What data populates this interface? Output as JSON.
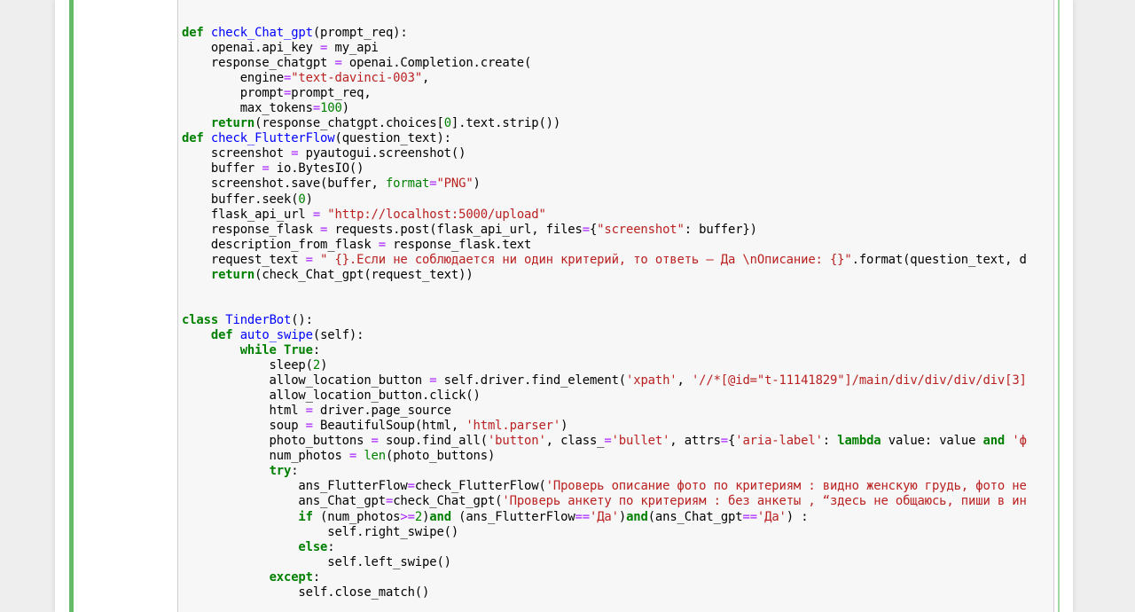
{
  "notebook": {
    "cell_state": "selected-edit",
    "accent_color": "#66bb6a",
    "code_lines": [
      [
        {
          "t": "kw",
          "v": "def"
        },
        {
          "t": "",
          "v": " "
        },
        {
          "t": "def",
          "v": "check_Chat_gpt"
        },
        {
          "t": "",
          "v": "(prompt_req):"
        }
      ],
      [
        {
          "t": "",
          "v": "    openai.api_key "
        },
        {
          "t": "op",
          "v": "="
        },
        {
          "t": "",
          "v": " my_api"
        }
      ],
      [
        {
          "t": "",
          "v": "    response_chatgpt "
        },
        {
          "t": "op",
          "v": "="
        },
        {
          "t": "",
          "v": " openai.Completion.create("
        }
      ],
      [
        {
          "t": "",
          "v": "        engine"
        },
        {
          "t": "op",
          "v": "="
        },
        {
          "t": "str",
          "v": "\"text-davinci-003\""
        },
        {
          "t": "",
          "v": ","
        }
      ],
      [
        {
          "t": "",
          "v": "        prompt"
        },
        {
          "t": "op",
          "v": "="
        },
        {
          "t": "",
          "v": "prompt_req,"
        }
      ],
      [
        {
          "t": "",
          "v": "        max_tokens"
        },
        {
          "t": "op",
          "v": "="
        },
        {
          "t": "num",
          "v": "100"
        },
        {
          "t": "",
          "v": ")"
        }
      ],
      [
        {
          "t": "",
          "v": "    "
        },
        {
          "t": "kw",
          "v": "return"
        },
        {
          "t": "",
          "v": "(response_chatgpt.choices["
        },
        {
          "t": "num",
          "v": "0"
        },
        {
          "t": "",
          "v": "].text.strip())"
        }
      ],
      [
        {
          "t": "kw",
          "v": "def"
        },
        {
          "t": "",
          "v": " "
        },
        {
          "t": "def",
          "v": "check_FlutterFlow"
        },
        {
          "t": "",
          "v": "(question_text):"
        }
      ],
      [
        {
          "t": "",
          "v": "    screenshot "
        },
        {
          "t": "op",
          "v": "="
        },
        {
          "t": "",
          "v": " pyautogui.screenshot()"
        }
      ],
      [
        {
          "t": "",
          "v": "    buffer "
        },
        {
          "t": "op",
          "v": "="
        },
        {
          "t": "",
          "v": " io.BytesIO()"
        }
      ],
      [
        {
          "t": "",
          "v": "    screenshot.save(buffer, "
        },
        {
          "t": "bi",
          "v": "format"
        },
        {
          "t": "op",
          "v": "="
        },
        {
          "t": "str",
          "v": "\"PNG\""
        },
        {
          "t": "",
          "v": ")"
        }
      ],
      [
        {
          "t": "",
          "v": "    buffer.seek("
        },
        {
          "t": "num",
          "v": "0"
        },
        {
          "t": "",
          "v": ")"
        }
      ],
      [
        {
          "t": "",
          "v": "    flask_api_url "
        },
        {
          "t": "op",
          "v": "="
        },
        {
          "t": "",
          "v": " "
        },
        {
          "t": "str",
          "v": "\"http://localhost:5000/upload\""
        }
      ],
      [
        {
          "t": "",
          "v": "    response_flask "
        },
        {
          "t": "op",
          "v": "="
        },
        {
          "t": "",
          "v": " requests.post(flask_api_url, files"
        },
        {
          "t": "op",
          "v": "="
        },
        {
          "t": "",
          "v": "{"
        },
        {
          "t": "str",
          "v": "\"screenshot\""
        },
        {
          "t": "",
          "v": ": buffer})"
        }
      ],
      [
        {
          "t": "",
          "v": "    description_from_flask "
        },
        {
          "t": "op",
          "v": "="
        },
        {
          "t": "",
          "v": " response_flask.text"
        }
      ],
      [
        {
          "t": "",
          "v": "    request_text "
        },
        {
          "t": "op",
          "v": "="
        },
        {
          "t": "",
          "v": " "
        },
        {
          "t": "str",
          "v": "\" {}.Если не соблюдается ни один критерий, то ответь – Да \\nОписание: {}\""
        },
        {
          "t": "",
          "v": ".format(question_text, d"
        }
      ],
      [
        {
          "t": "",
          "v": "    "
        },
        {
          "t": "kw",
          "v": "return"
        },
        {
          "t": "",
          "v": "(check_Chat_gpt(request_text))"
        }
      ],
      [],
      [],
      [
        {
          "t": "kw",
          "v": "class"
        },
        {
          "t": "",
          "v": " "
        },
        {
          "t": "cls",
          "v": "TinderBot"
        },
        {
          "t": "",
          "v": "():"
        }
      ],
      [
        {
          "t": "",
          "v": "    "
        },
        {
          "t": "kw",
          "v": "def"
        },
        {
          "t": "",
          "v": " "
        },
        {
          "t": "def",
          "v": "auto_swipe"
        },
        {
          "t": "",
          "v": "(self):"
        }
      ],
      [
        {
          "t": "",
          "v": "        "
        },
        {
          "t": "kw",
          "v": "while"
        },
        {
          "t": "",
          "v": " "
        },
        {
          "t": "kw",
          "v": "True"
        },
        {
          "t": "",
          "v": ":"
        }
      ],
      [
        {
          "t": "",
          "v": "            sleep("
        },
        {
          "t": "num",
          "v": "2"
        },
        {
          "t": "",
          "v": ")"
        }
      ],
      [
        {
          "t": "",
          "v": "            allow_location_button "
        },
        {
          "t": "op",
          "v": "="
        },
        {
          "t": "",
          "v": " self.driver.find_element("
        },
        {
          "t": "str",
          "v": "'xpath'"
        },
        {
          "t": "",
          "v": ", "
        },
        {
          "t": "str",
          "v": "'//*[@id=\"t-11141829\"]/main/div/div/div/div[3]"
        }
      ],
      [
        {
          "t": "",
          "v": "            allow_location_button.click()"
        }
      ],
      [
        {
          "t": "",
          "v": "            html "
        },
        {
          "t": "op",
          "v": "="
        },
        {
          "t": "",
          "v": " driver.page_source"
        }
      ],
      [
        {
          "t": "",
          "v": "            soup "
        },
        {
          "t": "op",
          "v": "="
        },
        {
          "t": "",
          "v": " BeautifulSoup(html, "
        },
        {
          "t": "str",
          "v": "'html.parser'"
        },
        {
          "t": "",
          "v": ")"
        }
      ],
      [
        {
          "t": "",
          "v": "            photo_buttons "
        },
        {
          "t": "op",
          "v": "="
        },
        {
          "t": "",
          "v": " soup.find_all("
        },
        {
          "t": "str",
          "v": "'button'"
        },
        {
          "t": "",
          "v": ", class_"
        },
        {
          "t": "op",
          "v": "="
        },
        {
          "t": "str",
          "v": "'bullet'"
        },
        {
          "t": "",
          "v": ", attrs"
        },
        {
          "t": "op",
          "v": "="
        },
        {
          "t": "",
          "v": "{"
        },
        {
          "t": "str",
          "v": "'aria-label'"
        },
        {
          "t": "",
          "v": ": "
        },
        {
          "t": "kw",
          "v": "lambda"
        },
        {
          "t": "",
          "v": " value: value "
        },
        {
          "t": "kw",
          "v": "and"
        },
        {
          "t": "",
          "v": " "
        },
        {
          "t": "str",
          "v": "'ф"
        }
      ],
      [
        {
          "t": "",
          "v": "            num_photos "
        },
        {
          "t": "op",
          "v": "="
        },
        {
          "t": "",
          "v": " "
        },
        {
          "t": "bi",
          "v": "len"
        },
        {
          "t": "",
          "v": "(photo_buttons)"
        }
      ],
      [
        {
          "t": "",
          "v": "            "
        },
        {
          "t": "kw",
          "v": "try"
        },
        {
          "t": "",
          "v": ":"
        }
      ],
      [
        {
          "t": "",
          "v": "                ans_FlutterFlow"
        },
        {
          "t": "op",
          "v": "="
        },
        {
          "t": "",
          "v": "check_FlutterFlow("
        },
        {
          "t": "str",
          "v": "'Проверь описание фото по критериям : видно женскую грудь, фото не"
        }
      ],
      [
        {
          "t": "",
          "v": "                ans_Chat_gpt"
        },
        {
          "t": "op",
          "v": "="
        },
        {
          "t": "",
          "v": "check_Chat_gpt("
        },
        {
          "t": "str",
          "v": "'Проверь анкету по критериям : без анкеты , “здесь не общаюсь, пиши в ин"
        }
      ],
      [
        {
          "t": "",
          "v": "                "
        },
        {
          "t": "kw",
          "v": "if"
        },
        {
          "t": "",
          "v": " (num_photos"
        },
        {
          "t": "op",
          "v": ">="
        },
        {
          "t": "num",
          "v": "2"
        },
        {
          "t": "",
          "v": ")"
        },
        {
          "t": "kw",
          "v": "and"
        },
        {
          "t": "",
          "v": " (ans_FlutterFlow"
        },
        {
          "t": "op",
          "v": "=="
        },
        {
          "t": "str",
          "v": "'Да'"
        },
        {
          "t": "",
          "v": ")"
        },
        {
          "t": "kw",
          "v": "and"
        },
        {
          "t": "",
          "v": "(ans_Chat_gpt"
        },
        {
          "t": "op",
          "v": "=="
        },
        {
          "t": "str",
          "v": "'Да'"
        },
        {
          "t": "",
          "v": ") :"
        }
      ],
      [
        {
          "t": "",
          "v": "                    self.right_swipe()"
        }
      ],
      [
        {
          "t": "",
          "v": "                "
        },
        {
          "t": "kw",
          "v": "else"
        },
        {
          "t": "",
          "v": ":"
        }
      ],
      [
        {
          "t": "",
          "v": "                    self.left_swipe()"
        }
      ],
      [
        {
          "t": "",
          "v": "            "
        },
        {
          "t": "kw",
          "v": "except"
        },
        {
          "t": "",
          "v": ":"
        }
      ],
      [
        {
          "t": "",
          "v": "                self.close_match()"
        }
      ]
    ]
  }
}
